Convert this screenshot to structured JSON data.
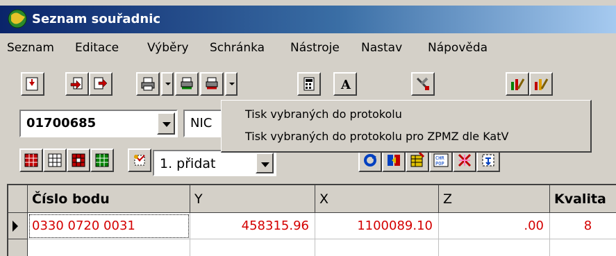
{
  "window": {
    "title": "Seznam souřadnic"
  },
  "menu": [
    "Seznam",
    "Editace",
    "Výběry",
    "Schránka",
    "Nástroje",
    "Nastav",
    "Nápověda"
  ],
  "filter": {
    "code_value": "01700685",
    "partial_value": "NIC"
  },
  "mode_combo": {
    "value": "1. přidat"
  },
  "popup_menu": {
    "items": [
      "Tisk vybraných do protokolu",
      "Tisk vybraných do protokolu pro ZPMZ dle KatV"
    ]
  },
  "grid": {
    "columns": [
      "Číslo bodu",
      "Y",
      "X",
      "Z",
      "Kvalita"
    ],
    "rows": [
      {
        "cislo": "0330 0720 0031",
        "y": "458315.96",
        "x": "1100089.10",
        "z": ".00",
        "kvalita": "8"
      }
    ],
    "text_color": "#d40000"
  },
  "icons": {
    "toolbar1": [
      "import-icon",
      "copy-out-icon",
      "export-icon",
      "print-icon",
      "print-selected-icon",
      "print-selected-red-icon",
      "calculator-icon",
      "font-icon",
      "tools-icon",
      "edit-chart-icon",
      "edit-chart-red-icon"
    ],
    "toolbar3": [
      "grid-red-icon",
      "grid-plain-icon",
      "grid-dotted-icon",
      "grid-color-icon",
      "select-icon",
      "refresh-icon",
      "swap-icon",
      "table-mark-icon",
      "chr-pop-icon",
      "cross-delete-icon",
      "transform-icon"
    ]
  },
  "colors": {
    "title_start": "#0a246a",
    "title_end": "#a6caf0",
    "face": "#d4d0c8"
  }
}
